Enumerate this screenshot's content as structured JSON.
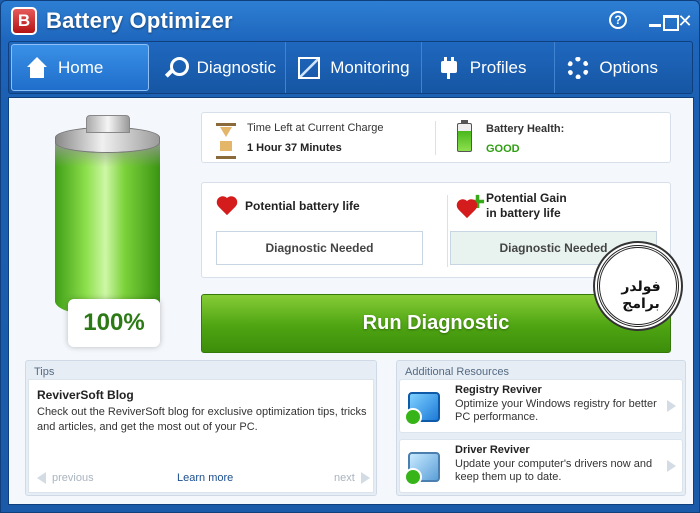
{
  "app": {
    "logo_letter": "B",
    "title": "Battery Optimizer"
  },
  "window_controls": {
    "help": "?",
    "close": "✕"
  },
  "nav": {
    "items": [
      {
        "label": "Home",
        "icon": "home-icon",
        "active": true
      },
      {
        "label": "Diagnostic",
        "icon": "magnifier-icon"
      },
      {
        "label": "Monitoring",
        "icon": "chart-icon"
      },
      {
        "label": "Profiles",
        "icon": "plug-icon"
      },
      {
        "label": "Options",
        "icon": "gear-icon"
      }
    ]
  },
  "battery": {
    "percent_label": "100%",
    "charge_level": 1.0
  },
  "time_left": {
    "label": "Time Left at Current Charge",
    "value": "1 Hour 37 Minutes"
  },
  "health": {
    "label": "Battery Health:",
    "value": "GOOD",
    "color": "#2f9e12"
  },
  "potential_life": {
    "label": "Potential battery life",
    "status": "Diagnostic Needed"
  },
  "potential_gain": {
    "label_line1": "Potential Gain",
    "label_line2": "in battery life",
    "status": "Diagnostic Needed"
  },
  "run_button": {
    "label": "Run Diagnostic",
    "color": "#4ea412"
  },
  "watermark": {
    "text": "فولدر برامج"
  },
  "tips": {
    "header": "Tips",
    "title": "ReviverSoft Blog",
    "text": "Check out the ReviverSoft blog for exclusive optimization tips, tricks and articles, and get the most out of your PC.",
    "previous": "previous",
    "learn_more": "Learn more",
    "next": "next"
  },
  "resources": {
    "header": "Additional Resources",
    "items": [
      {
        "title": "Registry Reviver",
        "description": "Optimize your Windows registry for better PC performance."
      },
      {
        "title": "Driver Reviver",
        "description": "Update your computer's drivers now and keep them up to date."
      }
    ]
  }
}
